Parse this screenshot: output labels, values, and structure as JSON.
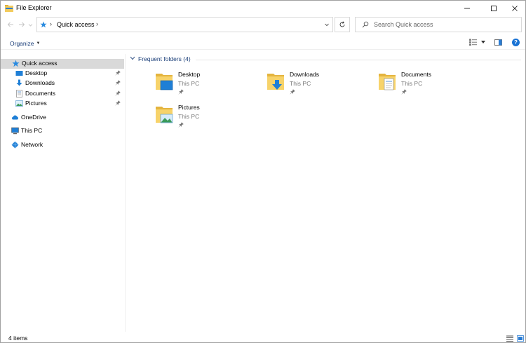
{
  "window": {
    "title": "File Explorer",
    "controls": {
      "minimize": "minimize-icon",
      "maximize": "maximize-icon",
      "close": "close-icon"
    }
  },
  "nav": {
    "back_icon": "back-arrow-icon",
    "forward_icon": "forward-arrow-icon",
    "address": {
      "icon": "quick-access-star-icon",
      "path": [
        "Quick access"
      ]
    },
    "refresh_icon": "refresh-icon",
    "search": {
      "placeholder": "Search Quick access"
    }
  },
  "command_bar": {
    "organize_label": "Organize",
    "view_icon": "change-view-icon",
    "preview_icon": "preview-pane-icon",
    "help_label": "?"
  },
  "sidebar": {
    "quick_access": "Quick access",
    "pinned": [
      {
        "label": "Desktop",
        "icon": "desktop-icon",
        "pinned": true
      },
      {
        "label": "Downloads",
        "icon": "downloads-icon",
        "pinned": true
      },
      {
        "label": "Documents",
        "icon": "documents-icon",
        "pinned": true
      },
      {
        "label": "Pictures",
        "icon": "pictures-icon",
        "pinned": true
      }
    ],
    "onedrive": "OneDrive",
    "this_pc": "This PC",
    "network": "Network"
  },
  "content": {
    "group_title": "Frequent folders (4)",
    "folders": [
      {
        "name": "Desktop",
        "location": "This PC",
        "overlay": "desktop"
      },
      {
        "name": "Downloads",
        "location": "This PC",
        "overlay": "downloads"
      },
      {
        "name": "Documents",
        "location": "This PC",
        "overlay": "documents"
      },
      {
        "name": "Pictures",
        "location": "This PC",
        "overlay": "pictures"
      }
    ]
  },
  "status": {
    "item_count": "4 items"
  },
  "colors": {
    "accent": "#1a73d4",
    "folder": "#f3cb5c",
    "selected_bg": "#d9d9d9",
    "link_text": "#1a3e78"
  }
}
